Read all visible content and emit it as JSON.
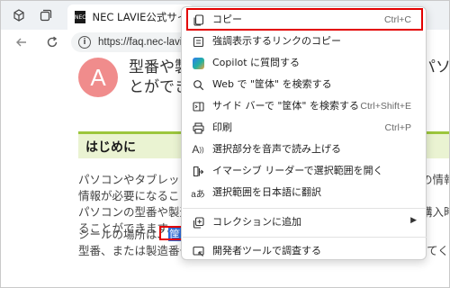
{
  "browser": {
    "tab_title": "NEC LAVIE公式サイト »",
    "tab_favicon": "NEC",
    "url": "https://faq.nec-lavie"
  },
  "page": {
    "avatar_letter": "A",
    "question_line1": "型番や製",
    "question_line2": "とができ",
    "question_right": "パソコ",
    "section_heading": "はじめに",
    "para1": [
      {
        "left": "パソコンやタブレット",
        "right": "の情報"
      },
      {
        "left": "情報が必要になること",
        "right": ""
      },
      {
        "left": "パソコンの型番や製造",
        "right": "購入時"
      },
      {
        "left": "ることができます。",
        "right": ""
      }
    ],
    "para2_prefix": "シールの場所は、",
    "para2_highlight": "筐体",
    "para2_suffix": "",
    "para2_line2": "型番、または製造番号を確認するには、ここで案内する内容を参照してください。"
  },
  "context_menu": {
    "items": [
      {
        "label": "コピー",
        "shortcut": "Ctrl+C",
        "icon": "copy-icon"
      },
      {
        "label": "強調表示するリンクのコピー",
        "shortcut": "",
        "icon": "link-copy-icon"
      },
      {
        "label": "Copilot に質問する",
        "shortcut": "",
        "icon": "copilot-icon"
      },
      {
        "label": "Web で \"筐体\" を検索する",
        "shortcut": "",
        "icon": "search-icon"
      },
      {
        "label": "サイド バーで \"筐体\" を検索する",
        "shortcut": "Ctrl+Shift+E",
        "icon": "sidebar-search-icon"
      },
      {
        "label": "印刷",
        "shortcut": "Ctrl+P",
        "icon": "print-icon"
      },
      {
        "label": "選択部分を音声で読み上げる",
        "shortcut": "",
        "icon": "read-aloud-icon"
      },
      {
        "label": "イマーシブ リーダーで選択範囲を開く",
        "shortcut": "",
        "icon": "immersive-reader-icon"
      },
      {
        "label": "選択範囲を日本語に翻訳",
        "shortcut": "",
        "icon": "translate-icon"
      },
      {
        "label": "コレクションに追加",
        "shortcut": "",
        "icon": "collections-icon"
      },
      {
        "label": "開発者ツールで調査する",
        "shortcut": "",
        "icon": "devtools-icon"
      }
    ]
  },
  "colors": {
    "highlight_box": "#e30000",
    "selection": "#2d6bd6",
    "section_accent": "#9cc63c",
    "avatar": "#f08c8c"
  }
}
